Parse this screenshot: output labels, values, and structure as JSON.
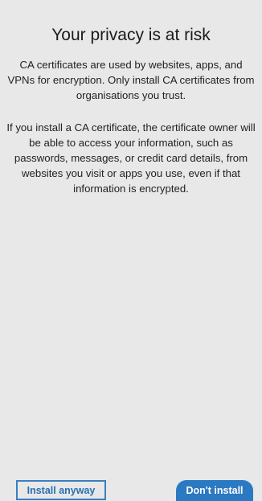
{
  "dialog": {
    "title": "Your privacy is at risk",
    "paragraph1": "CA certificates are used by websites, apps, and VPNs for encryption. Only install CA certificates from organisations you trust.",
    "paragraph2": "If you install a CA certificate, the certificate owner will be able to access your information, such as passwords, messages, or credit card details, from websites you visit or apps you use, even if that information is encrypted."
  },
  "actions": {
    "install_anyway_label": "Install anyway",
    "dont_install_label": "Don't install"
  },
  "colors": {
    "background": "#e8e8e8",
    "accent": "#2b79c2",
    "text": "#1a1a1a"
  }
}
